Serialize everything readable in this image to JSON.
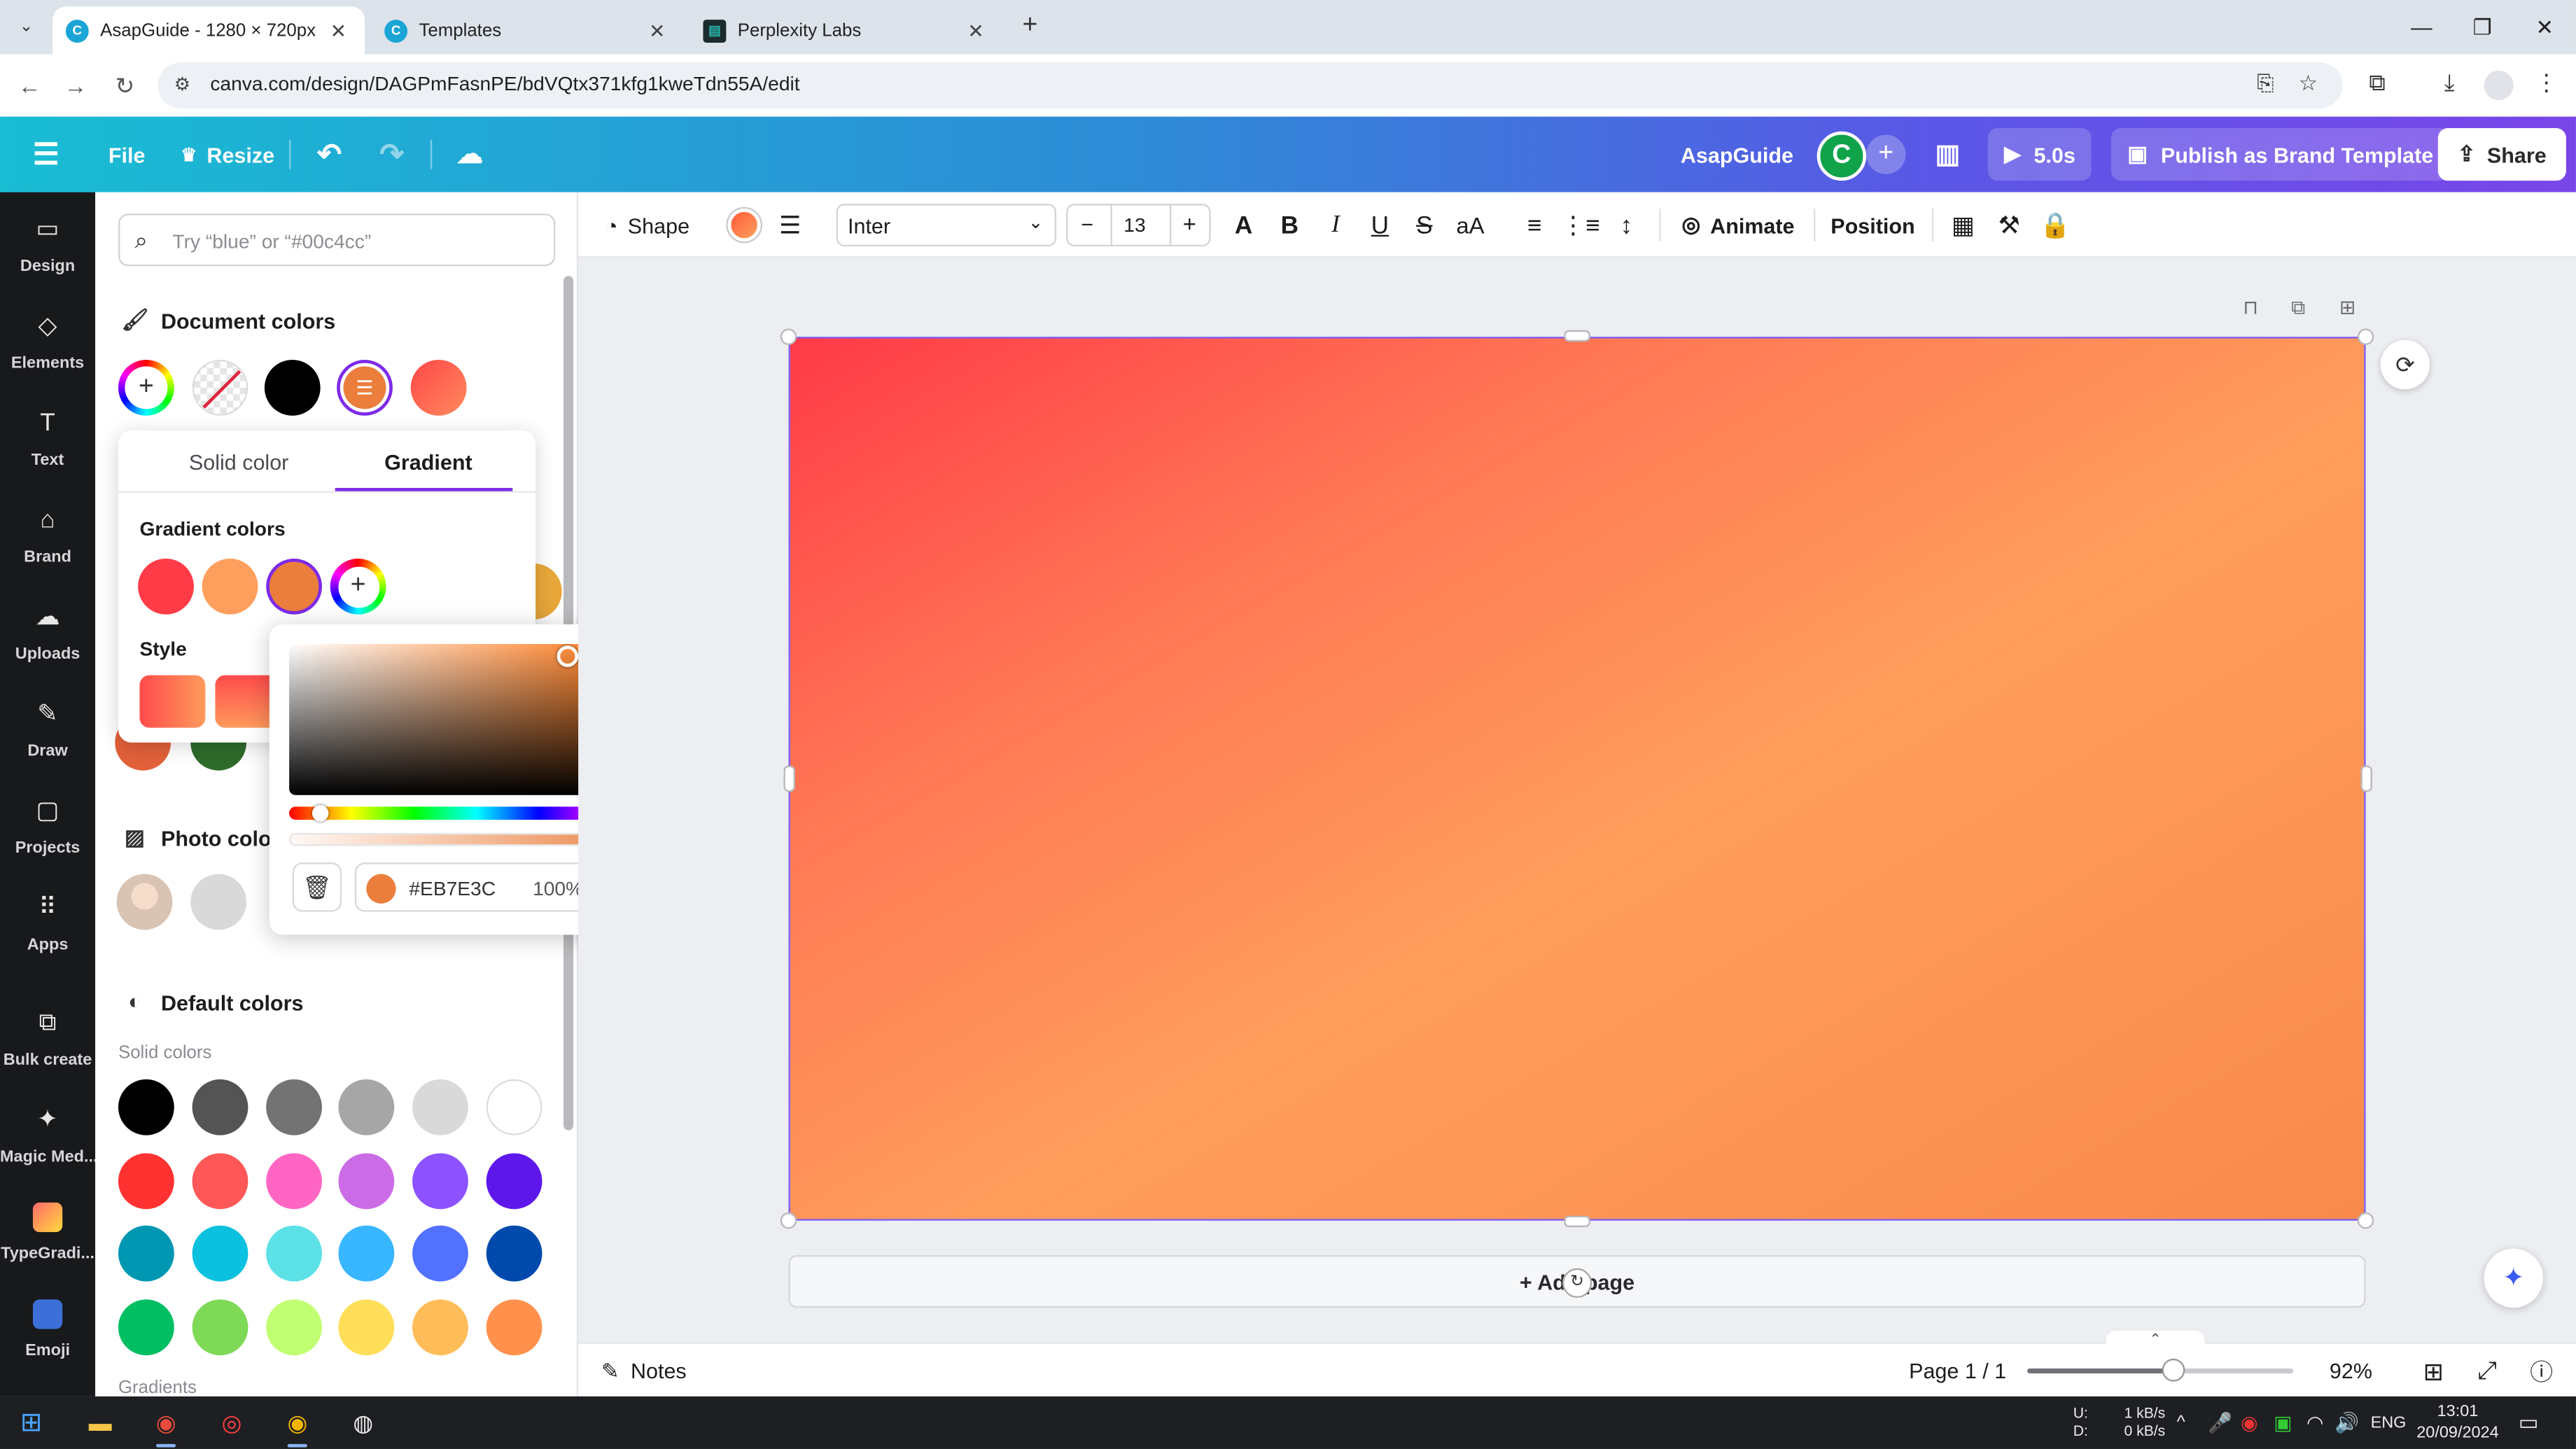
{
  "browser": {
    "tabs": [
      {
        "title": "AsapGuide - 1280 × 720px",
        "active": true
      },
      {
        "title": "Templates",
        "active": false
      },
      {
        "title": "Perplexity Labs",
        "active": false
      }
    ],
    "url": "canva.com/design/DAGPmFasnPE/bdVQtx371kfg1kweTdn55A/edit"
  },
  "header": {
    "file": "File",
    "resize": "Resize",
    "design_name": "AsapGuide",
    "avatar_letter": "C",
    "duration": "5.0s",
    "publish": "Publish as Brand Template",
    "share": "Share"
  },
  "rail": [
    {
      "label": "Design",
      "icon": "design-icon"
    },
    {
      "label": "Elements",
      "icon": "elements-icon"
    },
    {
      "label": "Text",
      "icon": "text-icon"
    },
    {
      "label": "Brand",
      "icon": "brand-icon"
    },
    {
      "label": "Uploads",
      "icon": "uploads-icon"
    },
    {
      "label": "Draw",
      "icon": "draw-icon"
    },
    {
      "label": "Projects",
      "icon": "projects-icon"
    },
    {
      "label": "Apps",
      "icon": "apps-icon"
    },
    {
      "label": "Bulk create",
      "icon": "bulk-create-icon"
    },
    {
      "label": "Magic Med...",
      "icon": "magic-media-icon"
    },
    {
      "label": "TypeGradi...",
      "icon": "typegradient-app-icon"
    },
    {
      "label": "Emoji",
      "icon": "emoji-app-icon"
    }
  ],
  "panel": {
    "search_placeholder": "Try “blue” or “#00c4cc”",
    "document_colors_title": "Document colors",
    "photo_colors_title": "Photo colors",
    "default_colors_title": "Default colors",
    "solid_colors_label": "Solid colors",
    "gradients_label": "Gradients",
    "document_colors": [
      "#000000",
      "#ff5a52"
    ],
    "default_solid_colors": [
      "#000000",
      "#545454",
      "#737373",
      "#a6a6a6",
      "#d9d9d9",
      "#ffffff",
      "#ff3131",
      "#ff5757",
      "#ff66c4",
      "#cb6ce6",
      "#8c52ff",
      "#5e17eb",
      "#0097b2",
      "#0cc0df",
      "#5ce1e6",
      "#38b6ff",
      "#5271ff",
      "#004aad",
      "#00bf63",
      "#7ed957",
      "#c1ff72",
      "#ffde59",
      "#ffbd59",
      "#ff914d"
    ]
  },
  "gradient_popover": {
    "tab_solid": "Solid color",
    "tab_gradient": "Gradient",
    "gradient_colors_title": "Gradient colors",
    "gradient_colors": [
      "#ff3b47",
      "#ff9f5e",
      "#eb7e3c"
    ],
    "style_title": "Style"
  },
  "picker": {
    "hex": "#EB7E3C",
    "opacity": "100%",
    "selected_color": "#EB7E3C"
  },
  "toolbar": {
    "shape": "Shape",
    "font": "Inter",
    "font_size": "13",
    "animate": "Animate",
    "position": "Position"
  },
  "canvas": {
    "add_page": "+ Add page"
  },
  "footer": {
    "notes": "Notes",
    "page": "Page 1 / 1",
    "zoom": "92%",
    "zoom_value": 0.55
  },
  "taskbar": {
    "net_up_label": "U:",
    "net_down_label": "D:",
    "net_up": "1 kB/s",
    "net_down": "0 kB/s",
    "lang": "ENG",
    "time": "13:01",
    "date": "20/09/2024"
  }
}
